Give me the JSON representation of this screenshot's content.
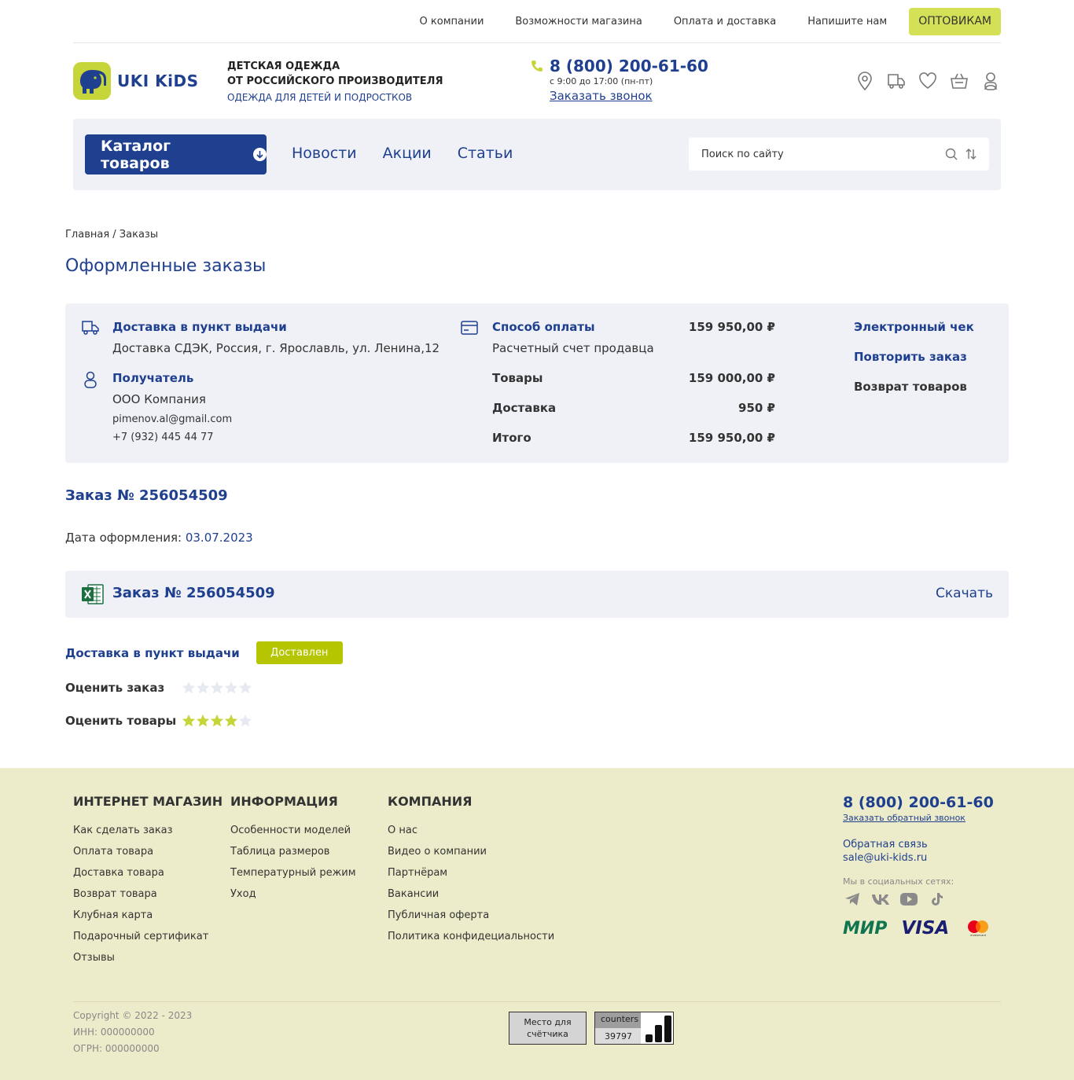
{
  "topnav": {
    "links": [
      "О компании",
      "Возможности магазина",
      "Оплата и доставка",
      "Напишите нам"
    ],
    "wholesale": "ОПТОВИКАМ"
  },
  "header": {
    "logo_text": "UKI KiDS",
    "tagline_1": "ДЕТСКАЯ ОДЕЖДА",
    "tagline_2": "ОТ РОССИЙСКОГО ПРОИЗВОДИТЕЛЯ",
    "tagline_3": "ОДЕЖДА ДЛЯ ДЕТЕЙ И ПОДРОСТКОВ",
    "phone": "8 (800) 200-61-60",
    "hours": "с 9:00 до 17:00 (пн-пт)",
    "callback": "Заказать звонок",
    "icons": [
      "location-icon",
      "delivery-truck-icon",
      "heart-icon",
      "basket-icon",
      "user-icon"
    ]
  },
  "menu": {
    "catalog": "Каталог товаров",
    "links": [
      "Новости",
      "Акции",
      "Статьи"
    ],
    "search_placeholder": "Поиск по сайту"
  },
  "breadcrumb": "Главная / Заказы",
  "page_title": "Оформленные заказы",
  "order_info": {
    "delivery_title": "Доставка в пункт выдачи",
    "delivery_address": "Доставка СДЭК, Россия, г. Ярославль, ул. Ленина,12",
    "recipient_title": "Получатель",
    "recipient_name": "ООО Компания",
    "recipient_email": "pimenov.al@gmail.com",
    "recipient_phone": "+7 (932) 445 44 77",
    "payment_title": "Способ оплаты",
    "payment_method": "Расчетный счет продавца",
    "payment_amount": "159 950,00 ₽",
    "goods_label": "Товары",
    "goods_amount": "159 000,00 ₽",
    "delivery_label": "Доставка",
    "delivery_amount": "950 ₽",
    "total_label": "Итого",
    "total_amount": "159 950,00 ₽",
    "action_receipt": "Электронный чек",
    "action_repeat": "Повторить заказ",
    "action_return": "Возврат товаров"
  },
  "order": {
    "title": "Заказ № 256054509",
    "date_label": "Дата оформления: ",
    "date_value": "03.07.2023",
    "file_name": "Заказ № 256054509",
    "download": "Скачать",
    "delivery_type": "Доставка в пункт выдачи",
    "status": "Доставлен",
    "rate_order_label": "Оценить заказ",
    "rate_order_value": 0,
    "rate_goods_label": "Оценить товары",
    "rate_goods_value": 4,
    "rating_max": 5
  },
  "colors": {
    "brand_blue": "#1f3f8f",
    "accent_green": "#d4e157",
    "status_green": "#b5c500",
    "star_active": "#c6d53a",
    "star_inactive": "#e6e9f0"
  },
  "footer": {
    "col1": {
      "title": "ИНТЕРНЕТ МАГАЗИН",
      "links": [
        "Как сделать заказ",
        "Оплата товара",
        "Доставка товара",
        "Возврат товара",
        "Клубная карта",
        "Подарочный сертификат",
        "Отзывы"
      ]
    },
    "col2": {
      "title": "ИНФОРМАЦИЯ",
      "links": [
        "Особенности моделей",
        "Таблица размеров",
        "Температурный режим",
        "Уход"
      ]
    },
    "col3": {
      "title": "КОМПАНИЯ",
      "links": [
        "О нас",
        "Видео о компании",
        "Партнёрам",
        "Вакансии",
        "Публичная оферта",
        "Политика конфидециальности"
      ]
    },
    "phone": "8 (800) 200-61-60",
    "callback": "Заказать обратный звонок",
    "feedback": "Обратная связь",
    "email": "sale@uki-kids.ru",
    "socials_label": "Мы в социальных сетях:",
    "socials": [
      "telegram-icon",
      "vk-icon",
      "youtube-icon",
      "tiktok-icon"
    ],
    "payments": [
      "МИР",
      "VISA",
      "mastercard"
    ],
    "copyright": "Copyright © 2022 - 2023",
    "inn": "ИНН: 000000000",
    "ogrn": "ОГРН: 000000000",
    "counter_placeholder_1": "Место для",
    "counter_placeholder_2": "счётчика",
    "counter_label": "counters",
    "counter_value": "39797"
  }
}
